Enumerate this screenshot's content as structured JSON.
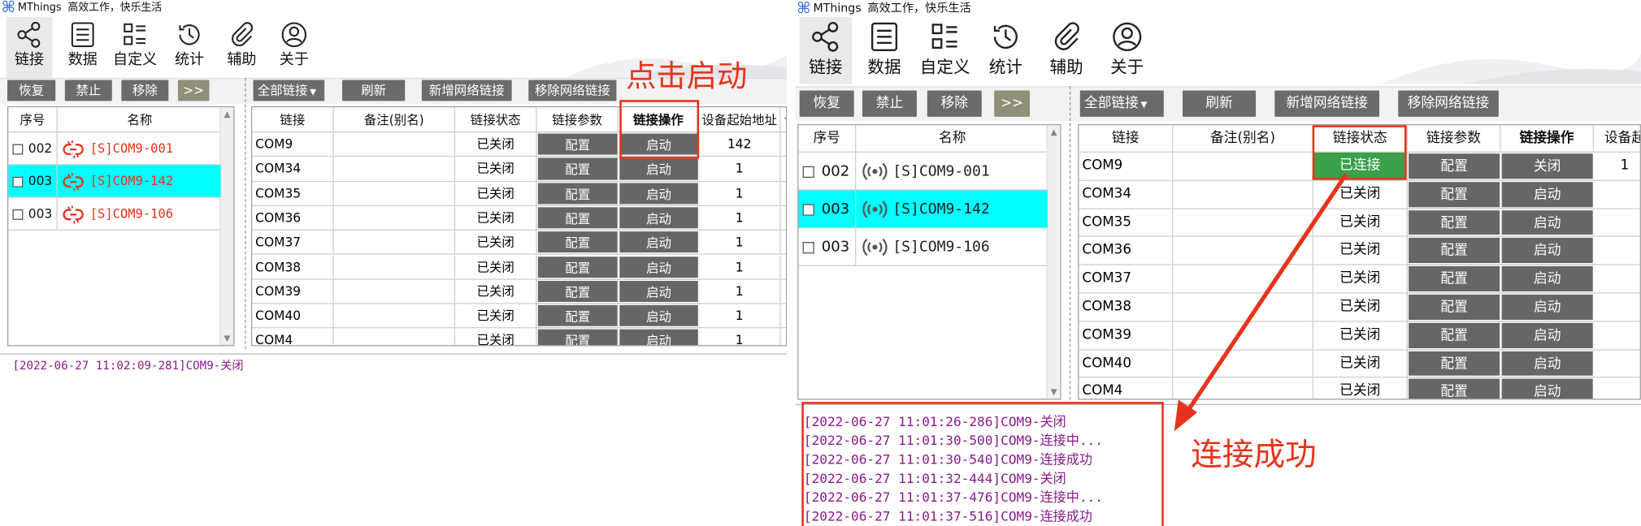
{
  "app": {
    "title": "MThings",
    "slogan": "高效工作，快乐生活"
  },
  "toolbar": [
    {
      "label": "链接",
      "icon": "share-icon"
    },
    {
      "label": "数据",
      "icon": "list-doc-icon"
    },
    {
      "label": "自定义",
      "icon": "grid-list-icon"
    },
    {
      "label": "统计",
      "icon": "history-clock-icon"
    },
    {
      "label": "辅助",
      "icon": "paperclip-icon"
    },
    {
      "label": "关于",
      "icon": "user-circle-icon"
    }
  ],
  "left_buttons": {
    "restore": "恢复",
    "disable": "禁止",
    "remove": "移除",
    "more": ">>"
  },
  "right_buttons": {
    "filter": "全部链接",
    "refresh": "刷新",
    "add_network": "新增网络链接",
    "remove_network": "移除网络链接"
  },
  "device_list": {
    "headers": {
      "index": "序号",
      "name": "名称"
    },
    "before": [
      {
        "index": "002",
        "name": "[S]COM9-001",
        "highlight": false
      },
      {
        "index": "003",
        "name": "[S]COM9-142",
        "highlight": true
      },
      {
        "index": "003",
        "name": "[S]COM9-106",
        "highlight": false
      }
    ],
    "after": [
      {
        "index": "002",
        "name": "[S]COM9-001",
        "highlight": false
      },
      {
        "index": "003",
        "name": "[S]COM9-142",
        "highlight": true
      },
      {
        "index": "003",
        "name": "[S]COM9-106",
        "highlight": false
      }
    ]
  },
  "link_table": {
    "headers": {
      "link": "链接",
      "note": "备注(别名)",
      "status": "链接状态",
      "params": "链接参数",
      "operation": "链接操作",
      "start_addr": "设备起始地址",
      "start_addr_clipped": "设备起",
      "extra": "设"
    },
    "before_rows": [
      {
        "link": "COM9",
        "status": "已关闭",
        "params": "配置",
        "op": "启动",
        "addr": "142"
      },
      {
        "link": "COM34",
        "status": "已关闭",
        "params": "配置",
        "op": "启动",
        "addr": "1"
      },
      {
        "link": "COM35",
        "status": "已关闭",
        "params": "配置",
        "op": "启动",
        "addr": "1"
      },
      {
        "link": "COM36",
        "status": "已关闭",
        "params": "配置",
        "op": "启动",
        "addr": "1"
      },
      {
        "link": "COM37",
        "status": "已关闭",
        "params": "配置",
        "op": "启动",
        "addr": "1"
      },
      {
        "link": "COM38",
        "status": "已关闭",
        "params": "配置",
        "op": "启动",
        "addr": "1"
      },
      {
        "link": "COM39",
        "status": "已关闭",
        "params": "配置",
        "op": "启动",
        "addr": "1"
      },
      {
        "link": "COM40",
        "status": "已关闭",
        "params": "配置",
        "op": "启动",
        "addr": "1"
      },
      {
        "link": "COM4",
        "status": "已关闭",
        "params": "配置",
        "op": "启动",
        "addr": "1"
      }
    ],
    "after_rows": [
      {
        "link": "COM9",
        "status": "已连接",
        "params": "配置",
        "op": "关闭",
        "addr": "1"
      },
      {
        "link": "COM34",
        "status": "已关闭",
        "params": "配置",
        "op": "启动",
        "addr": ""
      },
      {
        "link": "COM35",
        "status": "已关闭",
        "params": "配置",
        "op": "启动",
        "addr": ""
      },
      {
        "link": "COM36",
        "status": "已关闭",
        "params": "配置",
        "op": "启动",
        "addr": ""
      },
      {
        "link": "COM37",
        "status": "已关闭",
        "params": "配置",
        "op": "启动",
        "addr": ""
      },
      {
        "link": "COM38",
        "status": "已关闭",
        "params": "配置",
        "op": "启动",
        "addr": ""
      },
      {
        "link": "COM39",
        "status": "已关闭",
        "params": "配置",
        "op": "启动",
        "addr": ""
      },
      {
        "link": "COM40",
        "status": "已关闭",
        "params": "配置",
        "op": "启动",
        "addr": ""
      },
      {
        "link": "COM4",
        "status": "已关闭",
        "params": "配置",
        "op": "启动",
        "addr": ""
      }
    ]
  },
  "log_before": [
    "[2022-06-27 11:02:09-281]COM9-关闭"
  ],
  "log_after": [
    "[2022-06-27 11:01:26-286]COM9-关闭",
    "[2022-06-27 11:01:30-500]COM9-连接中...",
    "[2022-06-27 11:01:30-540]COM9-连接成功",
    "[2022-06-27 11:01:32-444]COM9-关闭",
    "[2022-06-27 11:01:37-476]COM9-连接中...",
    "[2022-06-27 11:01:37-516]COM9-连接成功"
  ],
  "annotations": {
    "click_start": "点击启动",
    "connect_success": "连接成功"
  },
  "colors": {
    "accent_red": "#e8331c",
    "highlight_cyan": "#00ffff",
    "button_gray": "#666666",
    "connected_green": "#3aa04a",
    "log_purple": "#8b1a8b"
  }
}
